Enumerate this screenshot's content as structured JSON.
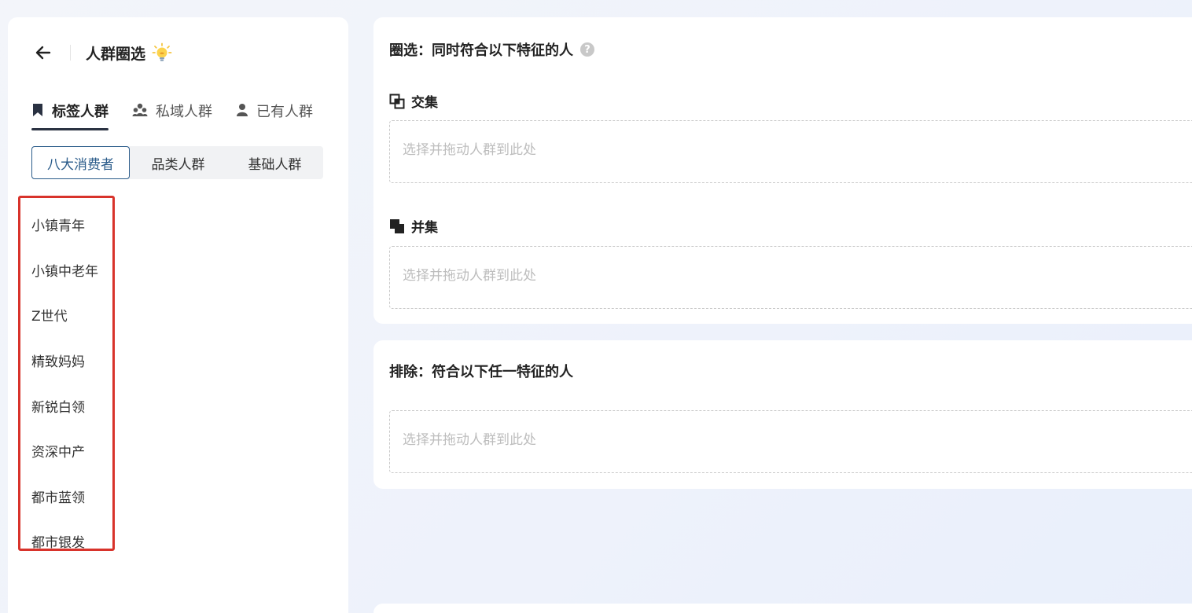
{
  "header": {
    "title": "人群圈选",
    "back_icon": "arrow-left-icon",
    "title_icon": "lightbulb-icon"
  },
  "tabs": [
    {
      "label": "标签人群",
      "icon": "bookmark-icon",
      "active": true
    },
    {
      "label": "私域人群",
      "icon": "group-icon",
      "active": false
    },
    {
      "label": "已有人群",
      "icon": "person-icon",
      "active": false
    }
  ],
  "segments": [
    {
      "label": "八大消费者",
      "active": true
    },
    {
      "label": "品类人群",
      "active": false
    },
    {
      "label": "基础人群",
      "active": false
    }
  ],
  "consumers": [
    "小镇青年",
    "小镇中老年",
    "Z世代",
    "精致妈妈",
    "新锐白领",
    "资深中产",
    "都市蓝领",
    "都市银发"
  ],
  "include": {
    "title": "圈选：同时符合以下特征的人",
    "help_icon": "question-circle-icon",
    "intersection": {
      "label": "交集",
      "icon": "intersection-icon",
      "placeholder": "选择并拖动人群到此处"
    },
    "union": {
      "label": "并集",
      "icon": "union-icon",
      "placeholder": "选择并拖动人群到此处"
    }
  },
  "exclude": {
    "title": "排除：符合以下任一特征的人",
    "placeholder": "选择并拖动人群到此处"
  },
  "colors": {
    "accent": "#2a5b8a",
    "tab_underline": "#2a3242",
    "highlight": "#d8332b"
  }
}
